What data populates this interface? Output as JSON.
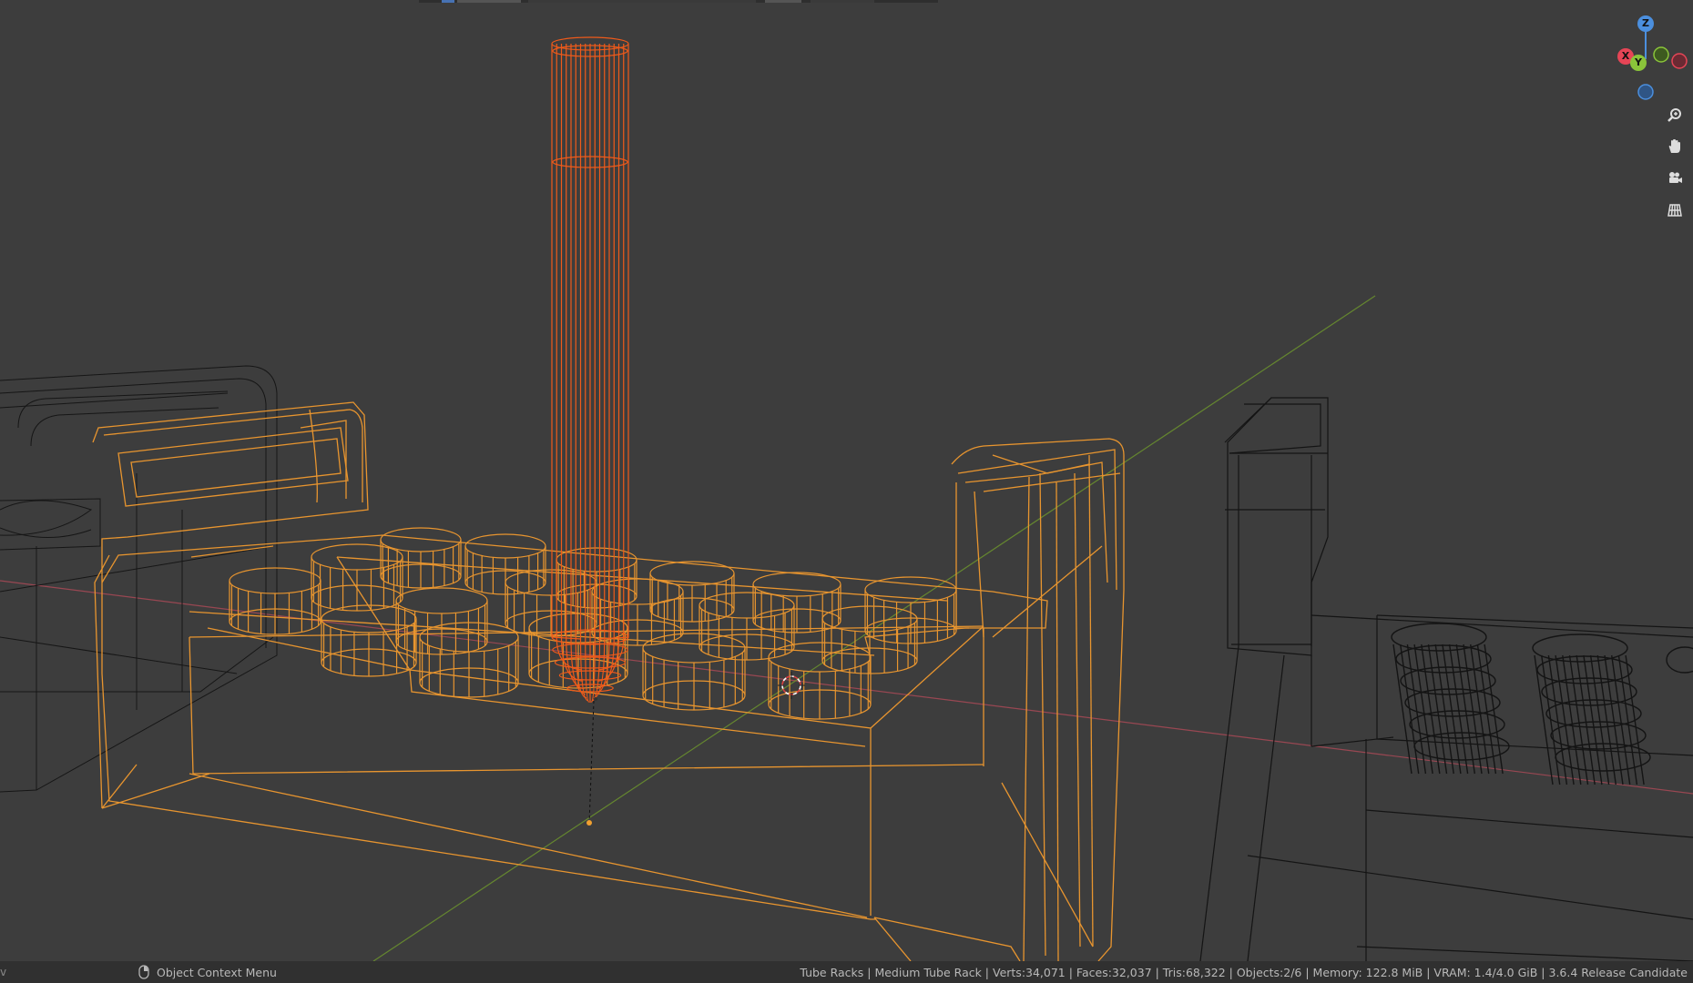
{
  "app": {
    "name": "Blender"
  },
  "viewport": {
    "shading": "wireframe"
  },
  "navigation": {
    "gizmo_axes": [
      "Z",
      "X",
      "Y"
    ],
    "tools": [
      "zoom-icon",
      "pan-hand-icon",
      "camera-icon",
      "ortho-grid-icon"
    ]
  },
  "statusbar": {
    "context_menu_label": "Object Context Menu",
    "scene_stats": "Tube Racks | Medium Tube Rack | Verts:34,071 | Faces:32,037 | Tris:68,322 | Objects:2/6 | Memory: 122.8 MiB | VRAM: 1.4/4.0 GiB | 3.6.4 Release Candidate"
  },
  "colors": {
    "background": "#3d3d3d",
    "selected_wire": "#e8952f",
    "active_wire": "#ef5a1a",
    "unselected_wire": "#141414",
    "x_axis": "#c0455a",
    "y_axis": "#7fa830",
    "gizmo_x": "#e64556",
    "gizmo_y": "#8ac43a",
    "gizmo_z": "#4b8fde"
  }
}
